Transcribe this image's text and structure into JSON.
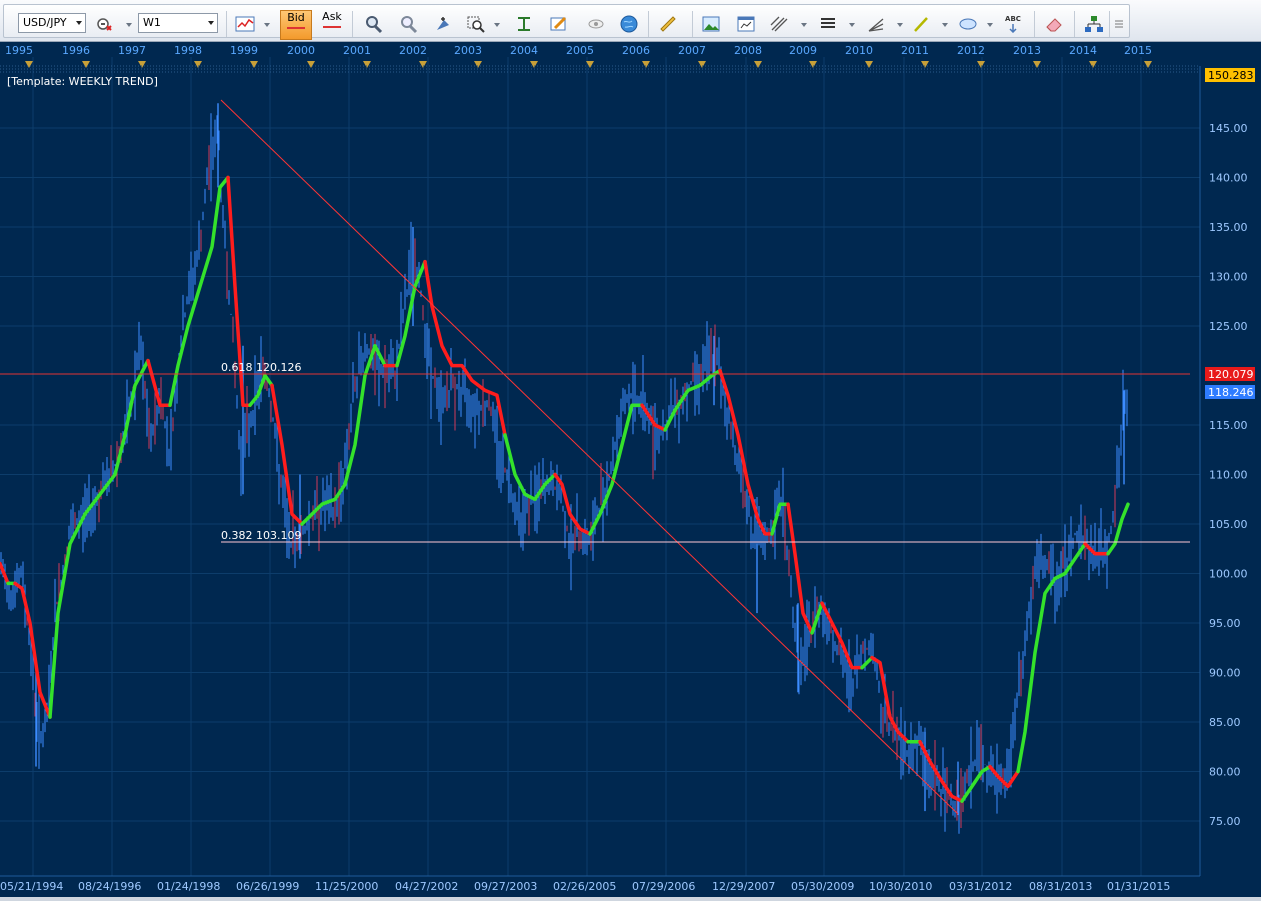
{
  "toolbar": {
    "symbol": "USD/JPY",
    "timeframe": "W1",
    "bid_label": "Bid",
    "ask_label": "Ask",
    "abc_label": "ABC",
    "icons": [
      "symbol-dropdown",
      "instrument-settings-icon",
      "timeframe-dropdown",
      "chart-type-icon",
      "bid-button",
      "ask-button",
      "crosshair-icon",
      "magnet-icon",
      "zoom-in-icon",
      "zoom-area-icon",
      "indicator-icon",
      "draw-text-icon",
      "eye-icon",
      "globe-icon",
      "ruler-icon",
      "image-icon",
      "template-icon",
      "fork-icon",
      "lines-icon",
      "fan-icon",
      "trendline-icon",
      "ellipse-icon",
      "text-abc-icon",
      "eraser-icon",
      "hierarchy-icon",
      "more-icon"
    ]
  },
  "chart": {
    "template_label": "[Template: WEEKLY TREND]",
    "years": [
      "1995",
      "1996",
      "1997",
      "1998",
      "1999",
      "2000",
      "2001",
      "2002",
      "2003",
      "2004",
      "2005",
      "2006",
      "2007",
      "2008",
      "2009",
      "2010",
      "2011",
      "2012",
      "2013",
      "2014",
      "2015"
    ],
    "date_labels": [
      "05/21/1994",
      "08/24/1996",
      "01/24/1998",
      "06/26/1999",
      "11/25/2000",
      "04/27/2002",
      "09/27/2003",
      "02/26/2005",
      "07/29/2006",
      "12/29/2007",
      "05/30/2009",
      "10/30/2010",
      "03/31/2012",
      "08/31/2013",
      "01/31/2015"
    ],
    "price_labels": [
      "145.00",
      "140.00",
      "135.00",
      "130.00",
      "125.00",
      "115.00",
      "110.00",
      "105.00",
      "100.00",
      "95.00",
      "90.00",
      "85.00",
      "80.00",
      "75.00"
    ],
    "top_price_badge": "150.283",
    "red_line_badge": "120.079",
    "current_price_badge": "118.246",
    "fib_618_label": "0.618 120.126",
    "fib_382_label": "0.382 103.109",
    "colors": {
      "background": "#002850",
      "grid": "#0d3d6b",
      "candles": "#3d8cff",
      "trend_up": "#34e22b",
      "trend_down": "#ff1d1d",
      "fib_line": "#ff3f3f"
    }
  }
}
